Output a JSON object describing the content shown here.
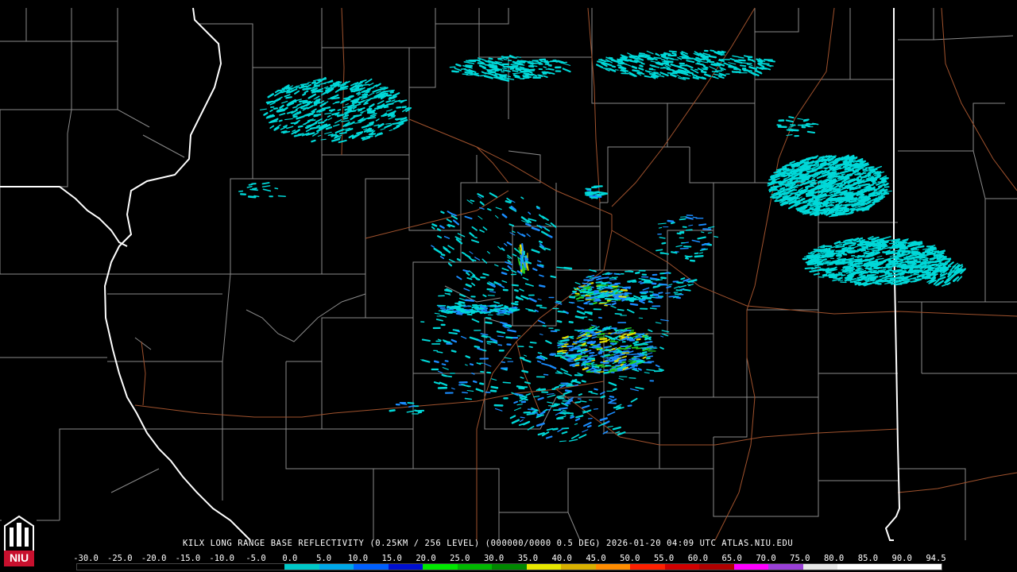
{
  "product_title": "KILX LONG RANGE BASE REFLECTIVITY (0.25KM / 256 LEVEL) (000000/0000 0.5 DEG) 2026-01-20 04:09 UTC  ATLAS.NIU.EDU",
  "logo_text": "NIU",
  "scale_labels": [
    "-30.0",
    "-25.0",
    "-20.0",
    "-15.0",
    "-10.0",
    "-5.0",
    "0.0",
    "5.0",
    "10.0",
    "15.0",
    "20.0",
    "25.0",
    "30.0",
    "35.0",
    "40.0",
    "45.0",
    "50.0",
    "55.0",
    "60.0",
    "65.0",
    "70.0",
    "75.0",
    "80.0",
    "85.0",
    "90.0",
    "94.5"
  ],
  "scale_colors": [
    "#000000",
    "#000000",
    "#000000",
    "#000000",
    "#000000",
    "#000000",
    "#00c8c8",
    "#00a8e8",
    "#0060ff",
    "#0010d0",
    "#00e800",
    "#00b800",
    "#008800",
    "#e8e800",
    "#d8b000",
    "#ff8c00",
    "#ff2000",
    "#d00000",
    "#b00000",
    "#ff00ff",
    "#9a40d8",
    "#e8e8e8",
    "#ffffff",
    "#ffffff",
    "#ffffff"
  ],
  "colors": {
    "background": "#000000",
    "county_lines": "#8a8a8a",
    "state_lines": "#ffffff",
    "highways": "#a0522d",
    "echo_light": "#00d8d8",
    "echo_mid": "#1a8cff",
    "echo_green": "#22cc22",
    "echo_yellow": "#e0e000"
  }
}
